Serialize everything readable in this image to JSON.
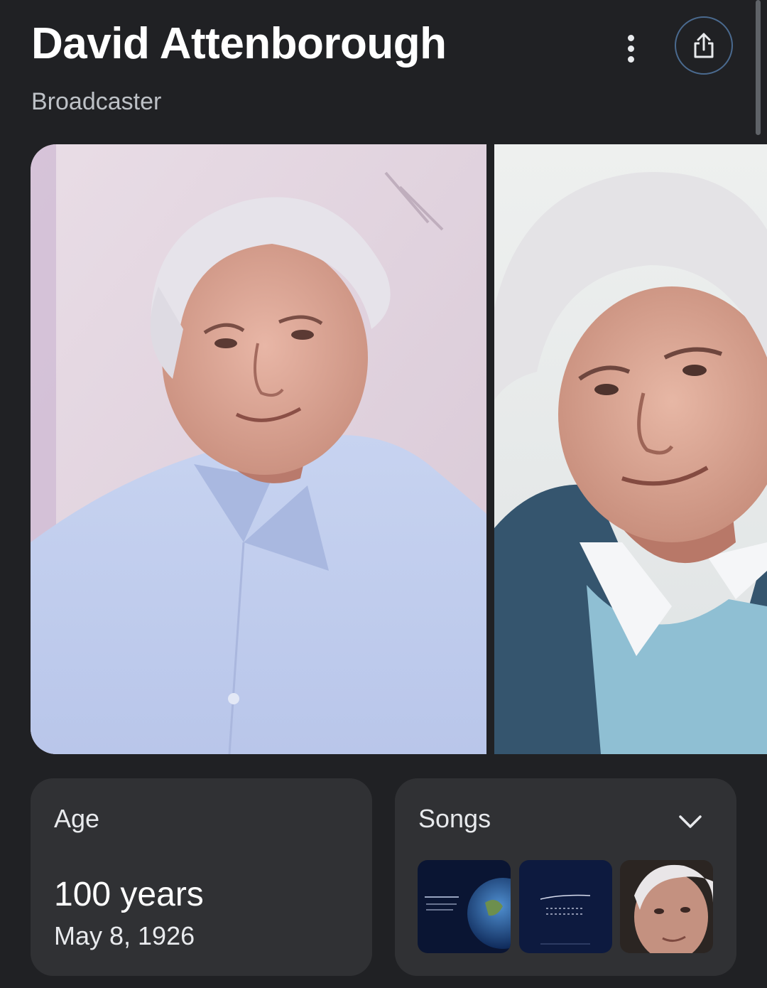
{
  "header": {
    "title": "David Attenborough",
    "subtitle": "Broadcaster",
    "more_icon": "more-vert-icon",
    "share_icon": "share-icon"
  },
  "images": [
    {
      "description_icon": "portrait-photo"
    },
    {
      "description_icon": "portrait-photo"
    }
  ],
  "age_card": {
    "label": "Age",
    "value": "100 years",
    "date": "May 8, 1926"
  },
  "songs_card": {
    "label": "Songs",
    "expand_icon": "chevron-down-icon",
    "thumbnails": 3
  },
  "colors": {
    "background": "#202124",
    "card": "#303134",
    "share_ring": "#4a6a8f"
  }
}
